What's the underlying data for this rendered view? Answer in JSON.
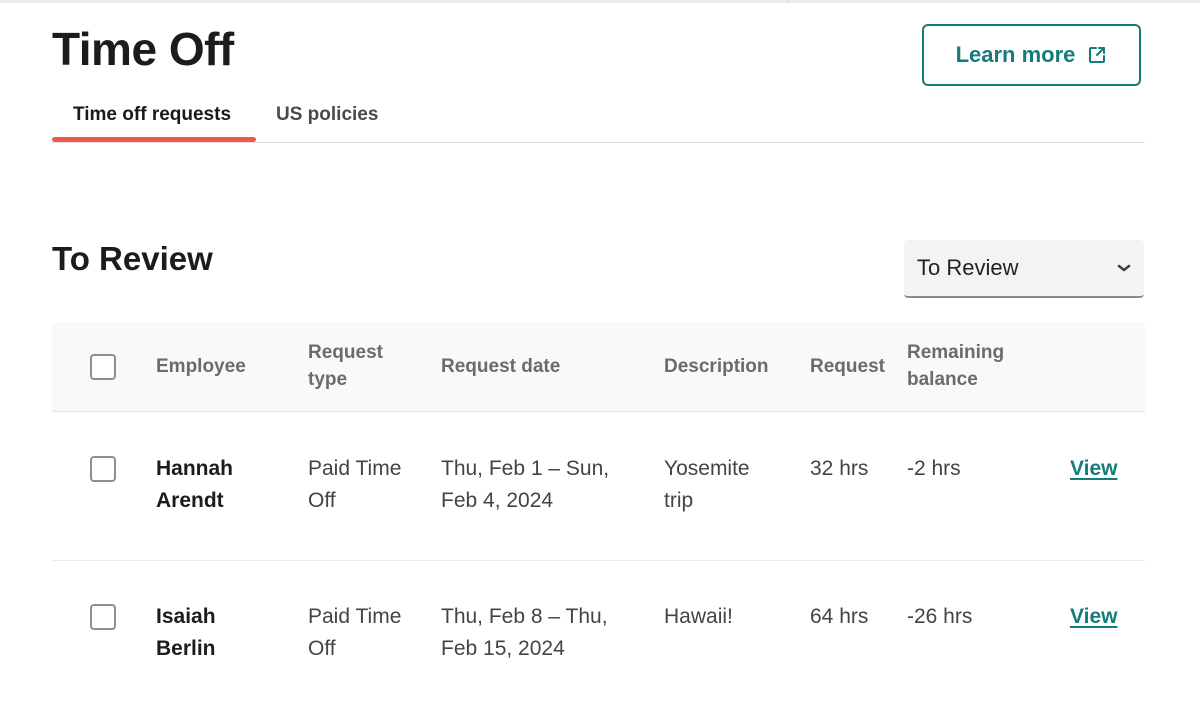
{
  "header": {
    "title": "Time Off",
    "learn_more_label": "Learn more",
    "learn_more_icon": "external-link-icon",
    "accent_color": "#147d7a"
  },
  "tabs": [
    {
      "label": "Time off requests",
      "active": true
    },
    {
      "label": "US policies",
      "active": false
    }
  ],
  "tab_indicator_color": "#ee5a47",
  "section": {
    "title": "To Review",
    "filter": {
      "selected": "To Review",
      "icon": "chevron-down-icon"
    }
  },
  "table": {
    "columns": {
      "employee": "Employee",
      "request_type_line1": "Request",
      "request_type_line2": "type",
      "request_date": "Request date",
      "description": "Description",
      "request": "Request",
      "remaining_line1": "Remaining",
      "remaining_line2": "balance"
    },
    "rows": [
      {
        "name_first": "Hannah",
        "name_last": "Arendt",
        "type_line1": "Paid Time",
        "type_line2": "Off",
        "date_line1": "Thu, Feb 1 – Sun,",
        "date_line2": "Feb 4, 2024",
        "desc_line1": "Yosemite",
        "desc_line2": "trip",
        "request": "32 hrs",
        "balance": "-2 hrs",
        "action": "View",
        "checked": false
      },
      {
        "name_first": "Isaiah",
        "name_last": "Berlin",
        "type_line1": "Paid Time",
        "type_line2": "Off",
        "date_line1": "Thu, Feb 8 – Thu,",
        "date_line2": "Feb 15, 2024",
        "desc_line1": "Hawaii!",
        "desc_line2": "",
        "request": "64 hrs",
        "balance": "-26 hrs",
        "action": "View",
        "checked": false
      }
    ]
  }
}
